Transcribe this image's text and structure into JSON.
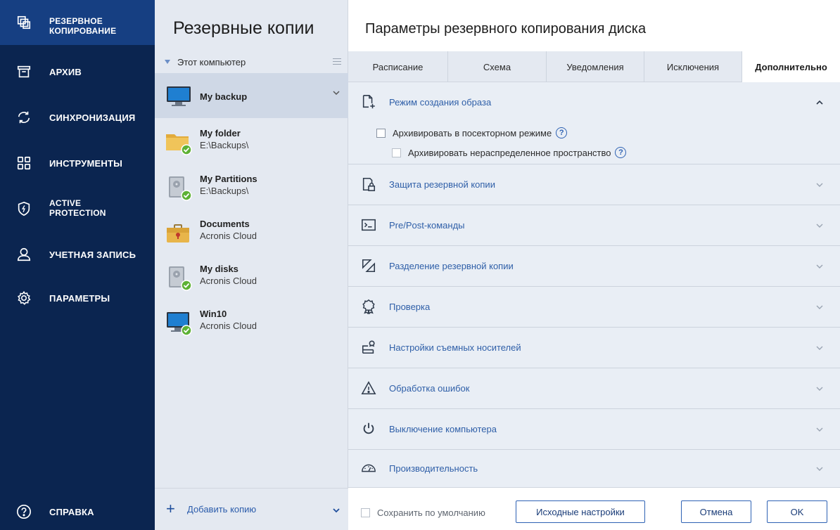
{
  "nav": {
    "items": [
      {
        "label": "РЕЗЕРВНОЕ\nКОПИРОВАНИЕ",
        "icon": "backup-icon"
      },
      {
        "label": "АРХИВ",
        "icon": "archive-icon"
      },
      {
        "label": "СИНХРОНИЗАЦИЯ",
        "icon": "sync-icon"
      },
      {
        "label": "ИНСТРУМЕНТЫ",
        "icon": "tools-icon"
      },
      {
        "label": "ACTIVE\nPROTECTION",
        "icon": "shield-icon"
      },
      {
        "label": "УЧЕТНАЯ ЗАПИСЬ",
        "icon": "account-icon"
      },
      {
        "label": "ПАРАМЕТРЫ",
        "icon": "gear-icon"
      }
    ],
    "help": {
      "label": "СПРАВКА",
      "icon": "help-icon"
    }
  },
  "backups": {
    "title": "Резервные копии",
    "source": "Этот компьютер",
    "items": [
      {
        "name": "My backup",
        "location": "",
        "icon": "monitor-icon"
      },
      {
        "name": "My folder",
        "location": "E:\\Backups\\",
        "icon": "folder-icon"
      },
      {
        "name": "My Partitions",
        "location": "E:\\Backups\\",
        "icon": "disk-icon"
      },
      {
        "name": "Documents",
        "location": "Acronis Cloud",
        "icon": "briefcase-icon"
      },
      {
        "name": "My disks",
        "location": "Acronis Cloud",
        "icon": "disk-icon"
      },
      {
        "name": "Win10",
        "location": "Acronis Cloud",
        "icon": "monitor-icon"
      }
    ],
    "add_label": "Добавить копию"
  },
  "settings": {
    "title": "Параметры резервного копирования диска",
    "tabs": [
      "Расписание",
      "Схема",
      "Уведомления",
      "Исключения",
      "Дополнительно"
    ],
    "active_tab": "Дополнительно",
    "sections": [
      {
        "label": "Режим создания образа",
        "icon": "image-mode-icon",
        "expanded": true
      },
      {
        "label": "Защита резервной копии",
        "icon": "lock-file-icon"
      },
      {
        "label": "Pre/Post-команды",
        "icon": "terminal-icon"
      },
      {
        "label": "Разделение резервной копии",
        "icon": "split-icon"
      },
      {
        "label": "Проверка",
        "icon": "badge-icon"
      },
      {
        "label": "Настройки съемных носителей",
        "icon": "removable-media-icon"
      },
      {
        "label": "Обработка ошибок",
        "icon": "warning-icon"
      },
      {
        "label": "Выключение компьютера",
        "icon": "power-icon"
      },
      {
        "label": "Производительность",
        "icon": "speedometer-icon"
      }
    ],
    "options": {
      "sector_by_sector": "Архивировать в посекторном режиме",
      "unallocated": "Архивировать нераспределенное пространство"
    },
    "footer": {
      "save_default": "Сохранить по умолчанию",
      "reset": "Исходные настройки",
      "cancel": "Отмена",
      "ok": "OK"
    }
  },
  "colors": {
    "nav_bg": "#0b2550",
    "nav_active": "#163f82",
    "accent": "#2e62b4",
    "panel_bg": "#e4e9f1",
    "link": "#2f5fa8",
    "check_green": "#5db134"
  }
}
